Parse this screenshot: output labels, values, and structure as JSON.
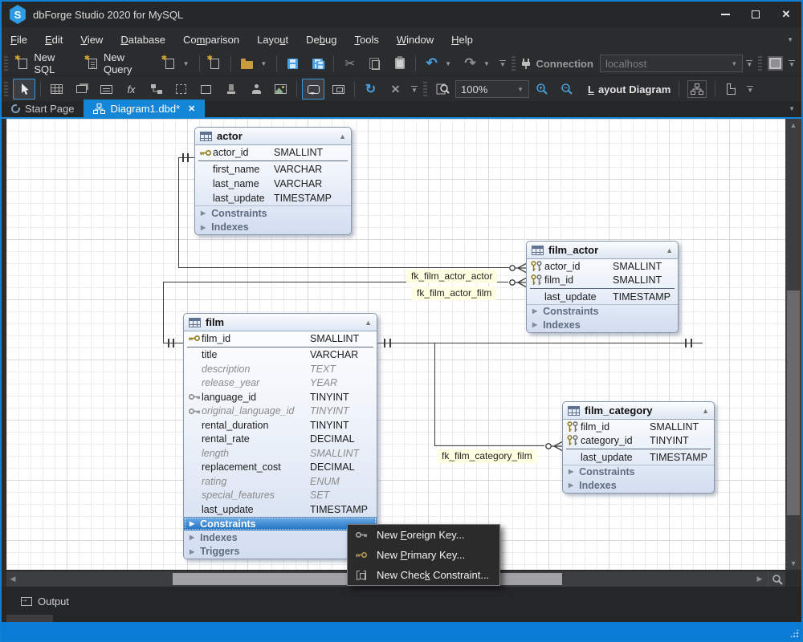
{
  "window": {
    "title": "dbForge Studio 2020 for MySQL",
    "logo_letter": "S"
  },
  "menu_bar": {
    "items": [
      {
        "pre": "",
        "u": "F",
        "post": "ile"
      },
      {
        "pre": "",
        "u": "E",
        "post": "dit"
      },
      {
        "pre": "",
        "u": "V",
        "post": "iew"
      },
      {
        "pre": "",
        "u": "D",
        "post": "atabase"
      },
      {
        "pre": "Co",
        "u": "m",
        "post": "parison"
      },
      {
        "pre": "Layo",
        "u": "u",
        "post": "t"
      },
      {
        "pre": "De",
        "u": "b",
        "post": "ug"
      },
      {
        "pre": "",
        "u": "T",
        "post": "ools"
      },
      {
        "pre": "",
        "u": "W",
        "post": "indow"
      },
      {
        "pre": "",
        "u": "H",
        "post": "elp"
      }
    ]
  },
  "toolbar_main": {
    "new_sql_label": "New SQL",
    "new_query_label": "New Query",
    "connection_label": "Connection",
    "connection_value": "localhost"
  },
  "toolbar_diagram": {
    "zoom_value": "100%",
    "layout_diagram": {
      "pre": "",
      "u": "L",
      "post": "ayout Diagram"
    },
    "fx_glyph": "fx"
  },
  "tabs": {
    "start_page": "Start Page",
    "diagram_tab": "Diagram1.dbd*"
  },
  "diagram": {
    "tables": [
      {
        "name": "actor",
        "pk_columns": [
          {
            "name": "actor_id",
            "type": "SMALLINT"
          }
        ],
        "columns": [
          {
            "name": "first_name",
            "type": "VARCHAR"
          },
          {
            "name": "last_name",
            "type": "VARCHAR"
          },
          {
            "name": "last_update",
            "type": "TIMESTAMP"
          }
        ],
        "sections": [
          {
            "label": "Constraints"
          },
          {
            "label": "Indexes"
          }
        ]
      },
      {
        "name": "film_actor",
        "pk_columns": [
          {
            "name": "actor_id",
            "type": "SMALLINT"
          },
          {
            "name": "film_id",
            "type": "SMALLINT"
          }
        ],
        "columns": [
          {
            "name": "last_update",
            "type": "TIMESTAMP"
          }
        ],
        "sections": [
          {
            "label": "Constraints"
          },
          {
            "label": "Indexes"
          }
        ]
      },
      {
        "name": "film",
        "pk_columns": [
          {
            "name": "film_id",
            "type": "SMALLINT"
          }
        ],
        "columns": [
          {
            "name": "title",
            "type": "VARCHAR"
          },
          {
            "name": "description",
            "type": "TEXT"
          },
          {
            "name": "release_year",
            "type": "YEAR"
          },
          {
            "name": "language_id",
            "type": "TINYINT"
          },
          {
            "name": "original_language_id",
            "type": "TINYINT"
          },
          {
            "name": "rental_duration",
            "type": "TINYINT"
          },
          {
            "name": "rental_rate",
            "type": "DECIMAL"
          },
          {
            "name": "length",
            "type": "SMALLINT"
          },
          {
            "name": "replacement_cost",
            "type": "DECIMAL"
          },
          {
            "name": "rating",
            "type": "ENUM"
          },
          {
            "name": "special_features",
            "type": "SET"
          },
          {
            "name": "last_update",
            "type": "TIMESTAMP"
          }
        ],
        "sections": [
          {
            "label": "Constraints",
            "selected": true
          },
          {
            "label": "Indexes"
          },
          {
            "label": "Triggers"
          }
        ]
      },
      {
        "name": "film_category",
        "pk_columns": [
          {
            "name": "film_id",
            "type": "SMALLINT"
          },
          {
            "name": "category_id",
            "type": "TINYINT"
          }
        ],
        "columns": [
          {
            "name": "last_update",
            "type": "TIMESTAMP"
          }
        ],
        "sections": [
          {
            "label": "Constraints"
          },
          {
            "label": "Indexes"
          }
        ]
      }
    ],
    "relationships": [
      {
        "label": "fk_film_actor_actor"
      },
      {
        "label": "fk_film_actor_film"
      },
      {
        "label": "fk_film_category_film"
      }
    ]
  },
  "context_menu": {
    "items": [
      {
        "pre": "New ",
        "u": "F",
        "post": "oreign Key..."
      },
      {
        "pre": "New ",
        "u": "P",
        "post": "rimary Key..."
      },
      {
        "pre": "New Chec",
        "u": "k",
        "post": " Constraint..."
      }
    ]
  },
  "output_panel": {
    "label": "Output"
  },
  "colors": {
    "accent_blue": "#1486d8",
    "status_bar": "#0a7cd6",
    "selection_blue": "#2f7fc4",
    "fk_label_bg": "#ffffe1",
    "pk_key_gold": "#8f7a1a",
    "fk_key_gray": "#8a8a8a"
  }
}
